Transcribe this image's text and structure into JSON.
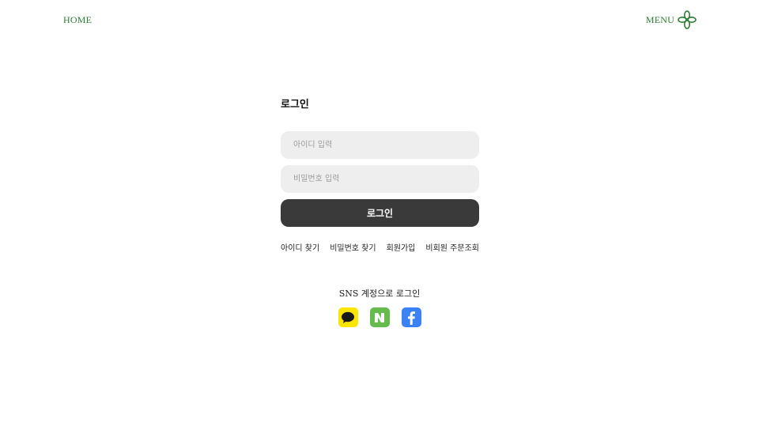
{
  "header": {
    "home_label": "HOME",
    "menu_label": "MENU"
  },
  "login": {
    "title": "로그인",
    "id_placeholder": "아이디 입력",
    "password_placeholder": "비밀번호 입력",
    "submit_label": "로그인",
    "links": {
      "find_id": "아이디 찾기",
      "find_password": "비밀번호 찾기",
      "signup": "회원가입",
      "guest_order": "비회원 주문조회"
    }
  },
  "sns": {
    "title": "SNS 계정으로 로그인",
    "providers": [
      {
        "icon": "kakao-icon",
        "color": "#fee500"
      },
      {
        "icon": "naver-icon",
        "color": "#66bb4f"
      },
      {
        "icon": "facebook-icon",
        "color": "#3b82f6"
      }
    ]
  },
  "colors": {
    "accent_green": "#2e7d32",
    "button_dark": "#3a3a3a",
    "field_bg": "#eeeeee"
  }
}
